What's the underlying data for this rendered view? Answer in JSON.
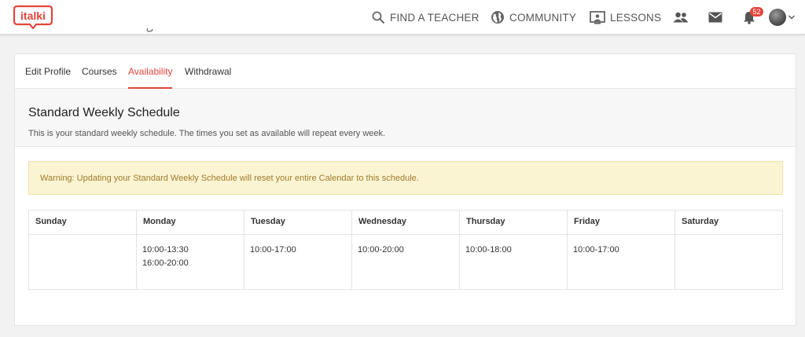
{
  "brand": {
    "logo_text": "italki",
    "accent": "#e2453c"
  },
  "nav": {
    "find_teacher": "FIND A TEACHER",
    "community": "COMMUNITY",
    "lessons": "LESSONS",
    "notification_count": "52"
  },
  "tabs": [
    {
      "label": "Edit Profile",
      "active": false
    },
    {
      "label": "Courses",
      "active": false
    },
    {
      "label": "Availability",
      "active": true
    },
    {
      "label": "Withdrawal",
      "active": false
    }
  ],
  "section": {
    "title": "Standard Weekly Schedule",
    "description": "This is your standard weekly schedule. The times you set as available will repeat every week."
  },
  "warning": "Warning: Updating your Standard Weekly Schedule will reset your entire Calendar to this schedule.",
  "schedule": {
    "days": [
      "Sunday",
      "Monday",
      "Tuesday",
      "Wednesday",
      "Thursday",
      "Friday",
      "Saturday"
    ],
    "slots": [
      [],
      [
        "10:00-13:30",
        "16:00-20:00"
      ],
      [
        "10:00-17:00"
      ],
      [
        "10:00-20:00"
      ],
      [
        "10:00-18:00"
      ],
      [
        "10:00-17:00"
      ],
      []
    ]
  }
}
